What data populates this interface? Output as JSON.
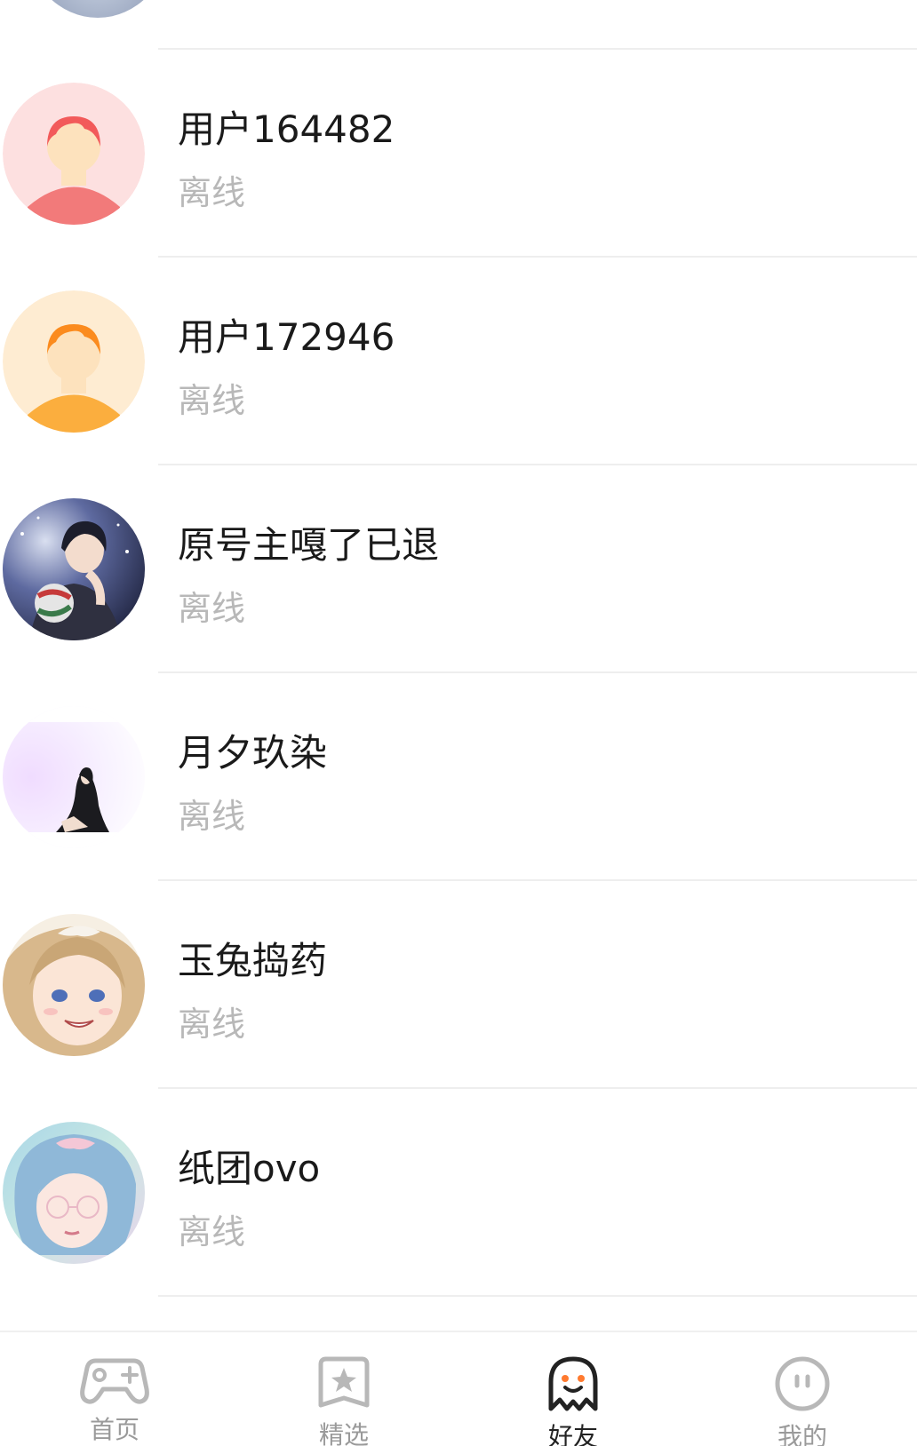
{
  "friends": [
    {
      "name": "用户164482",
      "status": "离线",
      "avatar": "default-avatar-red"
    },
    {
      "name": "用户172946",
      "status": "离线",
      "avatar": "default-avatar-orange"
    },
    {
      "name": "原号主嘎了已退",
      "status": "离线",
      "avatar": "anime-boy-volleyball"
    },
    {
      "name": "月夕玖染",
      "status": "离线",
      "avatar": "anime-girl-silhouette"
    },
    {
      "name": "玉兔捣药",
      "status": "离线",
      "avatar": "anime-girl-smiling"
    },
    {
      "name": "纸团ovo",
      "status": "离线",
      "avatar": "anime-boy-glasses"
    }
  ],
  "tabbar": {
    "items": [
      {
        "label": "首页",
        "icon": "gamepad-icon",
        "active": false
      },
      {
        "label": "精选",
        "icon": "star-bookmark-icon",
        "active": false
      },
      {
        "label": "好友",
        "icon": "ghost-icon",
        "active": true
      },
      {
        "label": "我的",
        "icon": "face-icon",
        "active": false
      }
    ]
  },
  "colors": {
    "accent": "#ff7a2f",
    "divider": "#eeeeee",
    "status_text": "#b8b8b8"
  }
}
